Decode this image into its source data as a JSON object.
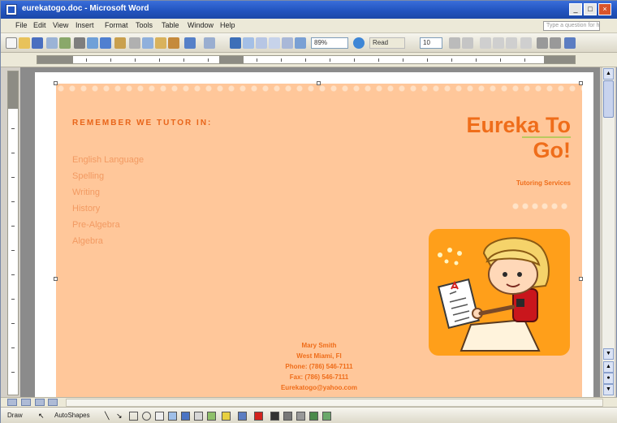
{
  "window": {
    "title": "eurekatogo.doc - Microsoft Word"
  },
  "menu": {
    "items": [
      "File",
      "Edit",
      "View",
      "Insert",
      "Format",
      "Tools",
      "Table",
      "Window",
      "Help"
    ],
    "help_placeholder": "Type a question for help"
  },
  "toolbar": {
    "zoom": "89%",
    "read_label": "Read",
    "font_size": "10"
  },
  "flyer": {
    "remember": "REMEMBER WE TUTOR IN:",
    "subjects": [
      "English Language",
      "Spelling",
      "Writing",
      "History",
      "Pre-Algebra",
      "Algebra"
    ],
    "brand_line1": "Eureka To",
    "brand_line2": "Go!",
    "tagline": "Tutoring Services",
    "contact": {
      "name": "Mary Smith",
      "city": "West Miami, Fl",
      "phone": "Phone: (786) 546-7111",
      "fax": "Fax: (786) 546-7111",
      "email": "Eurekatogo@yahoo.com"
    }
  },
  "drawbar": {
    "draw_label": "Draw",
    "autoshapes_label": "AutoShapes"
  },
  "colors": {
    "flyer_bg": "#ffc79a",
    "accent_orange": "#ef6d1a",
    "subject_text": "#f29a62",
    "clipart_bg": "#ff9f1a",
    "titlebar_blue": "#2456c2"
  },
  "icons": [
    "word-app-icon",
    "minimize-icon",
    "maximize-icon",
    "close-icon",
    "new-icon",
    "open-icon",
    "save-icon",
    "print-icon",
    "undo-icon",
    "redo-icon",
    "help-icon",
    "bold-icon",
    "bullets-icon",
    "highlight-icon",
    "font-color-icon",
    "select-arrow-icon",
    "line-icon",
    "arrow-icon",
    "rectangle-icon",
    "oval-icon"
  ]
}
